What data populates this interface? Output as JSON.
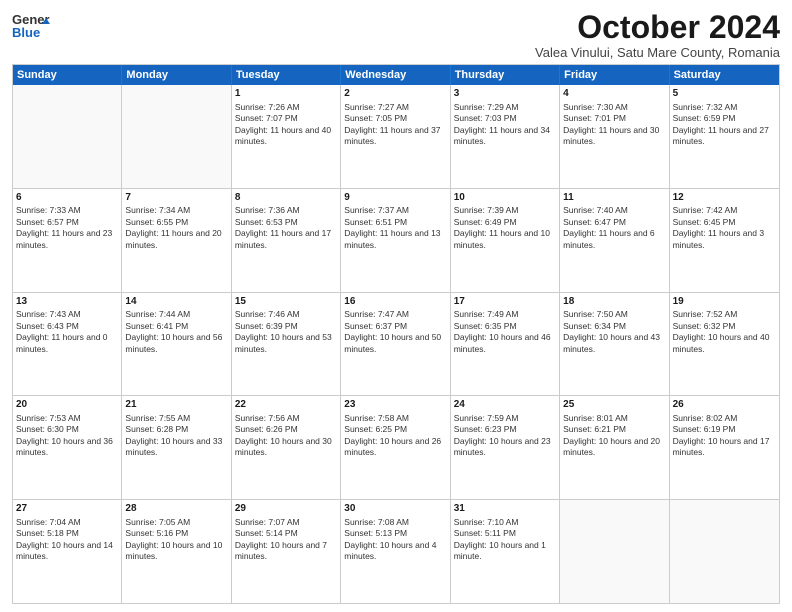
{
  "header": {
    "logo_general": "General",
    "logo_blue": "Blue",
    "month_title": "October 2024",
    "location": "Valea Vinului, Satu Mare County, Romania"
  },
  "weekdays": [
    "Sunday",
    "Monday",
    "Tuesday",
    "Wednesday",
    "Thursday",
    "Friday",
    "Saturday"
  ],
  "rows": [
    [
      {
        "day": "",
        "sunrise": "",
        "sunset": "",
        "daylight": ""
      },
      {
        "day": "",
        "sunrise": "",
        "sunset": "",
        "daylight": ""
      },
      {
        "day": "1",
        "sunrise": "Sunrise: 7:26 AM",
        "sunset": "Sunset: 7:07 PM",
        "daylight": "Daylight: 11 hours and 40 minutes."
      },
      {
        "day": "2",
        "sunrise": "Sunrise: 7:27 AM",
        "sunset": "Sunset: 7:05 PM",
        "daylight": "Daylight: 11 hours and 37 minutes."
      },
      {
        "day": "3",
        "sunrise": "Sunrise: 7:29 AM",
        "sunset": "Sunset: 7:03 PM",
        "daylight": "Daylight: 11 hours and 34 minutes."
      },
      {
        "day": "4",
        "sunrise": "Sunrise: 7:30 AM",
        "sunset": "Sunset: 7:01 PM",
        "daylight": "Daylight: 11 hours and 30 minutes."
      },
      {
        "day": "5",
        "sunrise": "Sunrise: 7:32 AM",
        "sunset": "Sunset: 6:59 PM",
        "daylight": "Daylight: 11 hours and 27 minutes."
      }
    ],
    [
      {
        "day": "6",
        "sunrise": "Sunrise: 7:33 AM",
        "sunset": "Sunset: 6:57 PM",
        "daylight": "Daylight: 11 hours and 23 minutes."
      },
      {
        "day": "7",
        "sunrise": "Sunrise: 7:34 AM",
        "sunset": "Sunset: 6:55 PM",
        "daylight": "Daylight: 11 hours and 20 minutes."
      },
      {
        "day": "8",
        "sunrise": "Sunrise: 7:36 AM",
        "sunset": "Sunset: 6:53 PM",
        "daylight": "Daylight: 11 hours and 17 minutes."
      },
      {
        "day": "9",
        "sunrise": "Sunrise: 7:37 AM",
        "sunset": "Sunset: 6:51 PM",
        "daylight": "Daylight: 11 hours and 13 minutes."
      },
      {
        "day": "10",
        "sunrise": "Sunrise: 7:39 AM",
        "sunset": "Sunset: 6:49 PM",
        "daylight": "Daylight: 11 hours and 10 minutes."
      },
      {
        "day": "11",
        "sunrise": "Sunrise: 7:40 AM",
        "sunset": "Sunset: 6:47 PM",
        "daylight": "Daylight: 11 hours and 6 minutes."
      },
      {
        "day": "12",
        "sunrise": "Sunrise: 7:42 AM",
        "sunset": "Sunset: 6:45 PM",
        "daylight": "Daylight: 11 hours and 3 minutes."
      }
    ],
    [
      {
        "day": "13",
        "sunrise": "Sunrise: 7:43 AM",
        "sunset": "Sunset: 6:43 PM",
        "daylight": "Daylight: 11 hours and 0 minutes."
      },
      {
        "day": "14",
        "sunrise": "Sunrise: 7:44 AM",
        "sunset": "Sunset: 6:41 PM",
        "daylight": "Daylight: 10 hours and 56 minutes."
      },
      {
        "day": "15",
        "sunrise": "Sunrise: 7:46 AM",
        "sunset": "Sunset: 6:39 PM",
        "daylight": "Daylight: 10 hours and 53 minutes."
      },
      {
        "day": "16",
        "sunrise": "Sunrise: 7:47 AM",
        "sunset": "Sunset: 6:37 PM",
        "daylight": "Daylight: 10 hours and 50 minutes."
      },
      {
        "day": "17",
        "sunrise": "Sunrise: 7:49 AM",
        "sunset": "Sunset: 6:35 PM",
        "daylight": "Daylight: 10 hours and 46 minutes."
      },
      {
        "day": "18",
        "sunrise": "Sunrise: 7:50 AM",
        "sunset": "Sunset: 6:34 PM",
        "daylight": "Daylight: 10 hours and 43 minutes."
      },
      {
        "day": "19",
        "sunrise": "Sunrise: 7:52 AM",
        "sunset": "Sunset: 6:32 PM",
        "daylight": "Daylight: 10 hours and 40 minutes."
      }
    ],
    [
      {
        "day": "20",
        "sunrise": "Sunrise: 7:53 AM",
        "sunset": "Sunset: 6:30 PM",
        "daylight": "Daylight: 10 hours and 36 minutes."
      },
      {
        "day": "21",
        "sunrise": "Sunrise: 7:55 AM",
        "sunset": "Sunset: 6:28 PM",
        "daylight": "Daylight: 10 hours and 33 minutes."
      },
      {
        "day": "22",
        "sunrise": "Sunrise: 7:56 AM",
        "sunset": "Sunset: 6:26 PM",
        "daylight": "Daylight: 10 hours and 30 minutes."
      },
      {
        "day": "23",
        "sunrise": "Sunrise: 7:58 AM",
        "sunset": "Sunset: 6:25 PM",
        "daylight": "Daylight: 10 hours and 26 minutes."
      },
      {
        "day": "24",
        "sunrise": "Sunrise: 7:59 AM",
        "sunset": "Sunset: 6:23 PM",
        "daylight": "Daylight: 10 hours and 23 minutes."
      },
      {
        "day": "25",
        "sunrise": "Sunrise: 8:01 AM",
        "sunset": "Sunset: 6:21 PM",
        "daylight": "Daylight: 10 hours and 20 minutes."
      },
      {
        "day": "26",
        "sunrise": "Sunrise: 8:02 AM",
        "sunset": "Sunset: 6:19 PM",
        "daylight": "Daylight: 10 hours and 17 minutes."
      }
    ],
    [
      {
        "day": "27",
        "sunrise": "Sunrise: 7:04 AM",
        "sunset": "Sunset: 5:18 PM",
        "daylight": "Daylight: 10 hours and 14 minutes."
      },
      {
        "day": "28",
        "sunrise": "Sunrise: 7:05 AM",
        "sunset": "Sunset: 5:16 PM",
        "daylight": "Daylight: 10 hours and 10 minutes."
      },
      {
        "day": "29",
        "sunrise": "Sunrise: 7:07 AM",
        "sunset": "Sunset: 5:14 PM",
        "daylight": "Daylight: 10 hours and 7 minutes."
      },
      {
        "day": "30",
        "sunrise": "Sunrise: 7:08 AM",
        "sunset": "Sunset: 5:13 PM",
        "daylight": "Daylight: 10 hours and 4 minutes."
      },
      {
        "day": "31",
        "sunrise": "Sunrise: 7:10 AM",
        "sunset": "Sunset: 5:11 PM",
        "daylight": "Daylight: 10 hours and 1 minute."
      },
      {
        "day": "",
        "sunrise": "",
        "sunset": "",
        "daylight": ""
      },
      {
        "day": "",
        "sunrise": "",
        "sunset": "",
        "daylight": ""
      }
    ]
  ]
}
